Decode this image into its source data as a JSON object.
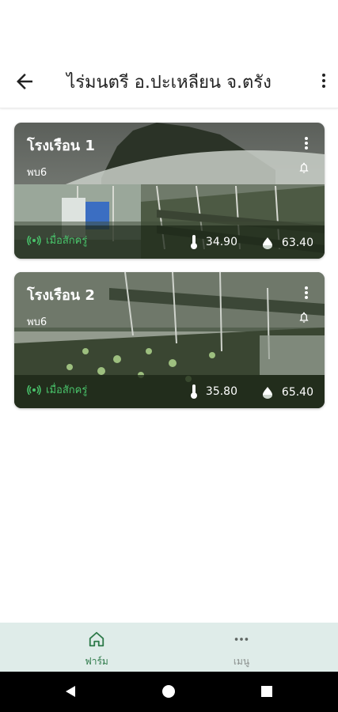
{
  "appbar": {
    "title": "ไร่มนตรี อ.ปะเหลียน จ.ตรัง"
  },
  "cards": [
    {
      "name": "โรงเรือน 1",
      "subtitle": "พบ6",
      "status": "เมื่อสักครู่",
      "temperature": "34.90",
      "humidity": "63.40"
    },
    {
      "name": "โรงเรือน 2",
      "subtitle": "พบ6",
      "status": "เมื่อสักครู่",
      "temperature": "35.80",
      "humidity": "65.40"
    }
  ],
  "bottom_nav": {
    "farm_label": "ฟาร์ม",
    "menu_label": "เมนู",
    "active_color": "#2e7a4a",
    "inactive_color": "#8a8f8d"
  }
}
